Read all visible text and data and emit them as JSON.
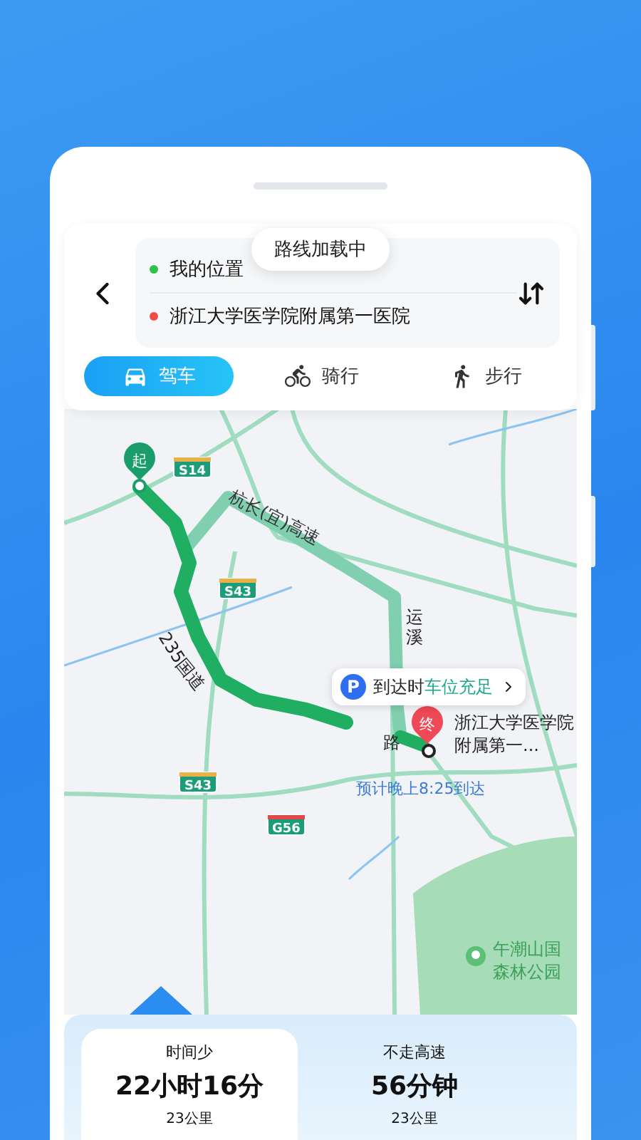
{
  "toast": "路线加载中",
  "route_inputs": {
    "origin": "我的位置",
    "destination": "浙江大学医学院附属第一医院"
  },
  "modes": [
    {
      "kind": "car",
      "label": "驾车",
      "selected": true
    },
    {
      "kind": "bike",
      "label": "骑行",
      "selected": false
    },
    {
      "kind": "walk",
      "label": "步行",
      "selected": false
    }
  ],
  "map": {
    "start_marker": "起",
    "end_marker": "终",
    "shields": [
      {
        "label": "S14",
        "kind": "provincial"
      },
      {
        "label": "S43",
        "kind": "provincial"
      },
      {
        "label": "S43",
        "kind": "provincial"
      },
      {
        "label": "G56",
        "kind": "national"
      }
    ],
    "road_labels": [
      "杭长(宜)高速",
      "235国道",
      "运溪",
      "路"
    ],
    "parking_callout": {
      "icon": "P",
      "prefix": "到达时",
      "status": "车位充足"
    },
    "destination_label": "浙江大学医学院附属第一...",
    "eta": "预计晚上8:25到达",
    "park_label": [
      "午潮山国",
      "森林公园"
    ]
  },
  "route_options": [
    {
      "tag": "时间少",
      "time": "22小时16分",
      "distance": "23公里",
      "selected": true
    },
    {
      "tag": "不走高速",
      "time": "56分钟",
      "distance": "23公里",
      "selected": false
    }
  ]
}
